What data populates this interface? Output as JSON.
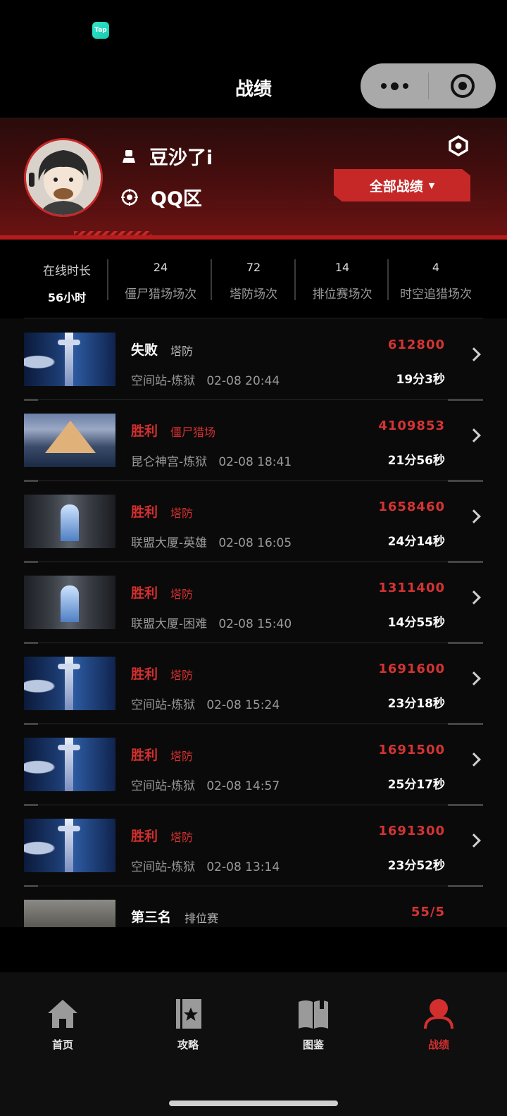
{
  "status_bar": {
    "app_badge": "Tap"
  },
  "header": {
    "title": "战绩"
  },
  "profile": {
    "name": "豆沙了i",
    "zone": "QQ区",
    "filter_label": "全部战绩"
  },
  "stats": [
    {
      "value": "在线时长",
      "label": "56小时"
    },
    {
      "value": "24",
      "label": "僵尸猎场场次"
    },
    {
      "value": "72",
      "label": "塔防场次"
    },
    {
      "value": "14",
      "label": "排位赛场次"
    },
    {
      "value": "4",
      "label": "时空追猎场次"
    }
  ],
  "records": [
    {
      "result": "失败",
      "mode": "塔防",
      "place": "空间站-炼狱",
      "time": "02-08 20:44",
      "score": "612800",
      "duration": "19分3秒"
    },
    {
      "result": "胜利",
      "mode": "僵尸猎场",
      "place": "昆仑神宫-炼狱",
      "time": "02-08 18:41",
      "score": "4109853",
      "duration": "21分56秒"
    },
    {
      "result": "胜利",
      "mode": "塔防",
      "place": "联盟大厦-英雄",
      "time": "02-08 16:05",
      "score": "1658460",
      "duration": "24分14秒"
    },
    {
      "result": "胜利",
      "mode": "塔防",
      "place": "联盟大厦-困难",
      "time": "02-08 15:40",
      "score": "1311400",
      "duration": "14分55秒"
    },
    {
      "result": "胜利",
      "mode": "塔防",
      "place": "空间站-炼狱",
      "time": "02-08 15:24",
      "score": "1691600",
      "duration": "23分18秒"
    },
    {
      "result": "胜利",
      "mode": "塔防",
      "place": "空间站-炼狱",
      "time": "02-08 14:57",
      "score": "1691500",
      "duration": "25分17秒"
    },
    {
      "result": "胜利",
      "mode": "塔防",
      "place": "空间站-炼狱",
      "time": "02-08 13:14",
      "score": "1691300",
      "duration": "23分52秒"
    },
    {
      "result": "第三名",
      "mode": "排位赛",
      "place": "",
      "time": "",
      "score": "55/5",
      "duration": ""
    }
  ],
  "tabs": [
    {
      "label": "首页",
      "icon": "home-icon"
    },
    {
      "label": "攻略",
      "icon": "guide-book-icon"
    },
    {
      "label": "图鉴",
      "icon": "open-book-icon"
    },
    {
      "label": "战绩",
      "icon": "user-icon"
    }
  ],
  "colors": {
    "accent": "#d32f2f",
    "background": "#0a0a0a",
    "header_gradient_end": "#6d1313"
  }
}
